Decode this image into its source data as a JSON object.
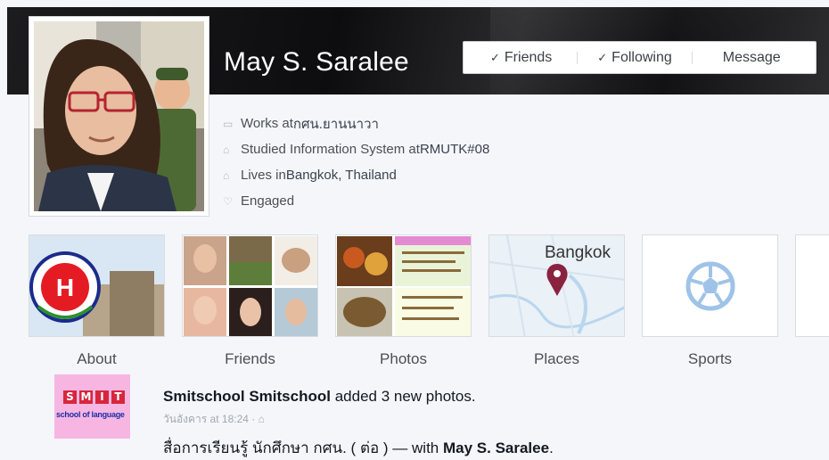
{
  "profile": {
    "name": "May S. Saralee",
    "actions": {
      "friends": "Friends",
      "following": "Following",
      "message": "Message",
      "check_glyph": "✓"
    },
    "info": [
      {
        "icon": "work-icon",
        "prefix": "Works at ",
        "value": "กศน.ยานนาวา"
      },
      {
        "icon": "education-icon",
        "prefix": "Studied Information System at ",
        "value": "RMUTK#08"
      },
      {
        "icon": "home-icon",
        "prefix": "Lives in ",
        "value": "Bangkok, Thailand"
      },
      {
        "icon": "heart-icon",
        "prefix": "",
        "value": "Engaged"
      }
    ]
  },
  "tiles": [
    {
      "label": "About"
    },
    {
      "label": "Friends"
    },
    {
      "label": "Photos"
    },
    {
      "label": "Places",
      "map_label": "Bangkok"
    },
    {
      "label": "Sports"
    }
  ],
  "feed": {
    "avatar_text": "SMIT",
    "avatar_subtext": "school of language",
    "author": "Smitschool Smitschool",
    "action": " added 3 new photos.",
    "time": "วันอังคาร at 18:24 · ",
    "post_text": "สื่อการเรียนรู้ นักศึกษา กศน. ( ต่อ ) — with ",
    "tagged": "May S. Saralee",
    "tail": "."
  },
  "colors": {
    "accent_map_pin": "#8a2340",
    "sports_ball": "#9fc3e8",
    "avatar_bg": "#f7b6e2"
  }
}
